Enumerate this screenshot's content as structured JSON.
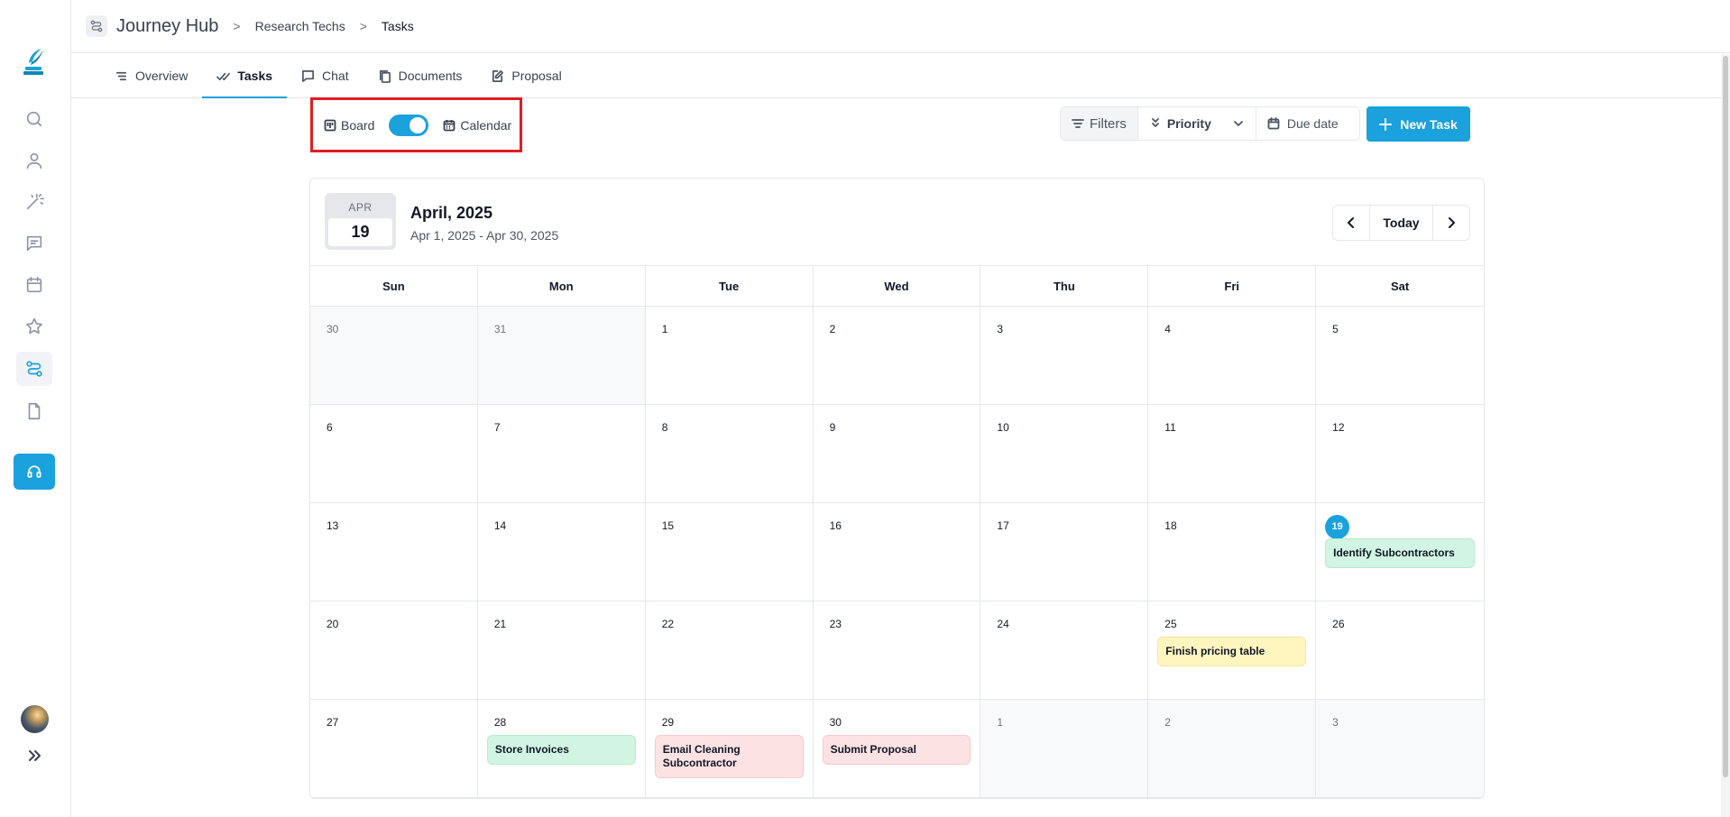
{
  "header": {
    "app_title": "Journey Hub",
    "breadcrumbs": [
      "Research Techs",
      "Tasks"
    ],
    "separator": ">"
  },
  "tabs": [
    {
      "label": "Overview",
      "icon": "list-icon"
    },
    {
      "label": "Tasks",
      "icon": "check-icon",
      "active": true
    },
    {
      "label": "Chat",
      "icon": "chat-icon"
    },
    {
      "label": "Documents",
      "icon": "documents-icon"
    },
    {
      "label": "Proposal",
      "icon": "edit-icon"
    }
  ],
  "view_toggle": {
    "left_label": "Board",
    "right_label": "Calendar",
    "calendar_on": true
  },
  "filters": {
    "filters_label": "Filters",
    "priority_label": "Priority",
    "due_date_label": "Due date"
  },
  "new_task_label": "New Task",
  "calendar": {
    "badge_month": "APR",
    "badge_day": "19",
    "title": "April, 2025",
    "range": "Apr 1, 2025 - Apr 30, 2025",
    "today_label": "Today",
    "weekdays": [
      "Sun",
      "Mon",
      "Tue",
      "Wed",
      "Thu",
      "Fri",
      "Sat"
    ],
    "days": [
      {
        "n": "30",
        "other": true
      },
      {
        "n": "31",
        "other": true
      },
      {
        "n": "1"
      },
      {
        "n": "2"
      },
      {
        "n": "3"
      },
      {
        "n": "4"
      },
      {
        "n": "5"
      },
      {
        "n": "6"
      },
      {
        "n": "7"
      },
      {
        "n": "8"
      },
      {
        "n": "9"
      },
      {
        "n": "10"
      },
      {
        "n": "11"
      },
      {
        "n": "12"
      },
      {
        "n": "13"
      },
      {
        "n": "14"
      },
      {
        "n": "15"
      },
      {
        "n": "16"
      },
      {
        "n": "17"
      },
      {
        "n": "18"
      },
      {
        "n": "19",
        "today": true,
        "event": {
          "title": "Identify Subcontractors",
          "color": "green"
        }
      },
      {
        "n": "20"
      },
      {
        "n": "21"
      },
      {
        "n": "22"
      },
      {
        "n": "23"
      },
      {
        "n": "24"
      },
      {
        "n": "25",
        "event": {
          "title": "Finish pricing table",
          "color": "yellow"
        }
      },
      {
        "n": "26"
      },
      {
        "n": "27"
      },
      {
        "n": "28",
        "event": {
          "title": "Store Invoices",
          "color": "green"
        }
      },
      {
        "n": "29",
        "event": {
          "title": "Email Cleaning Subcontractor",
          "color": "pink"
        }
      },
      {
        "n": "30",
        "event": {
          "title": "Submit Proposal",
          "color": "pink"
        }
      },
      {
        "n": "1",
        "other": true
      },
      {
        "n": "2",
        "other": true
      },
      {
        "n": "3",
        "other": true
      }
    ]
  },
  "colors": {
    "accent": "#1ba1dc",
    "highlight_border": "#e11d24",
    "event_green": "#d1f5e2",
    "event_yellow": "#fef5bf",
    "event_pink": "#fde2e3"
  }
}
